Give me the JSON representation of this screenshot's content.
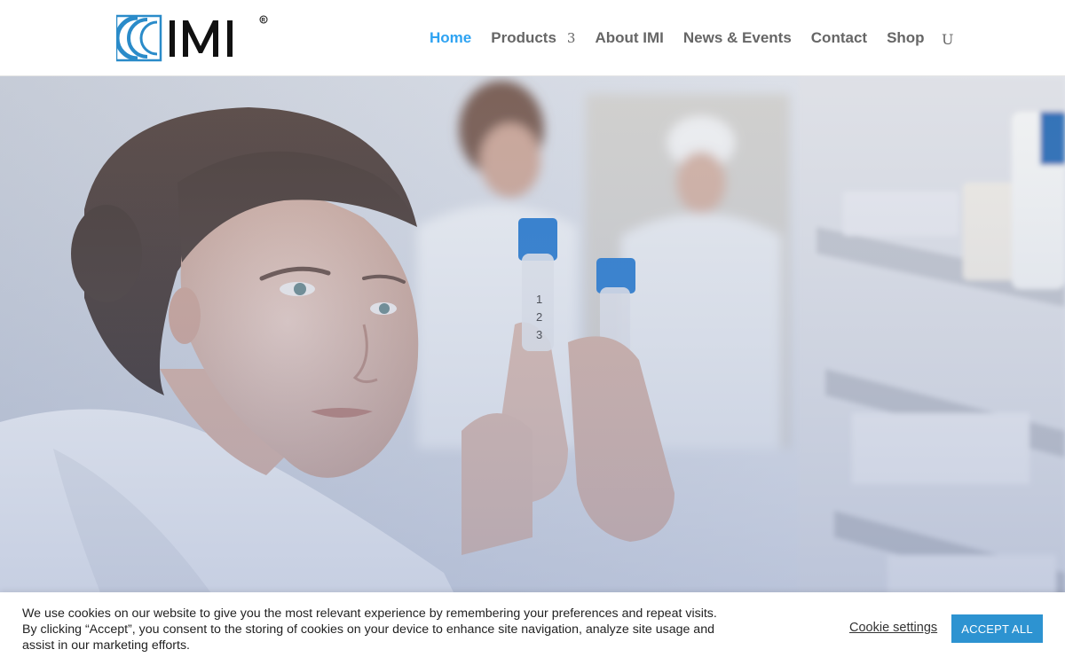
{
  "brand": {
    "logo_text": "IMI",
    "registered_mark": "®",
    "logo_color": "#2a8bc9"
  },
  "nav": {
    "items": [
      {
        "label": "Home",
        "active": true
      },
      {
        "label": "Products",
        "caret": "3"
      },
      {
        "label": "About IMI"
      },
      {
        "label": "News & Events"
      },
      {
        "label": "Contact"
      },
      {
        "label": "Shop"
      }
    ],
    "search_icon": "U",
    "active_color": "#2ea3f2",
    "text_color": "#666666"
  },
  "hero": {
    "image_description_icon": "photo-icon"
  },
  "cookie_banner": {
    "message": "We use cookies on our website to give you the most relevant experience by remembering your preferences and repeat visits. By clicking “Accept”, you consent to the storing of cookies on your device to enhance site navigation, analyze site usage and assist in our marketing efforts.",
    "settings_label": "Cookie settings",
    "accept_label": "ACCEPT ALL",
    "accept_color": "#2d93d1"
  }
}
